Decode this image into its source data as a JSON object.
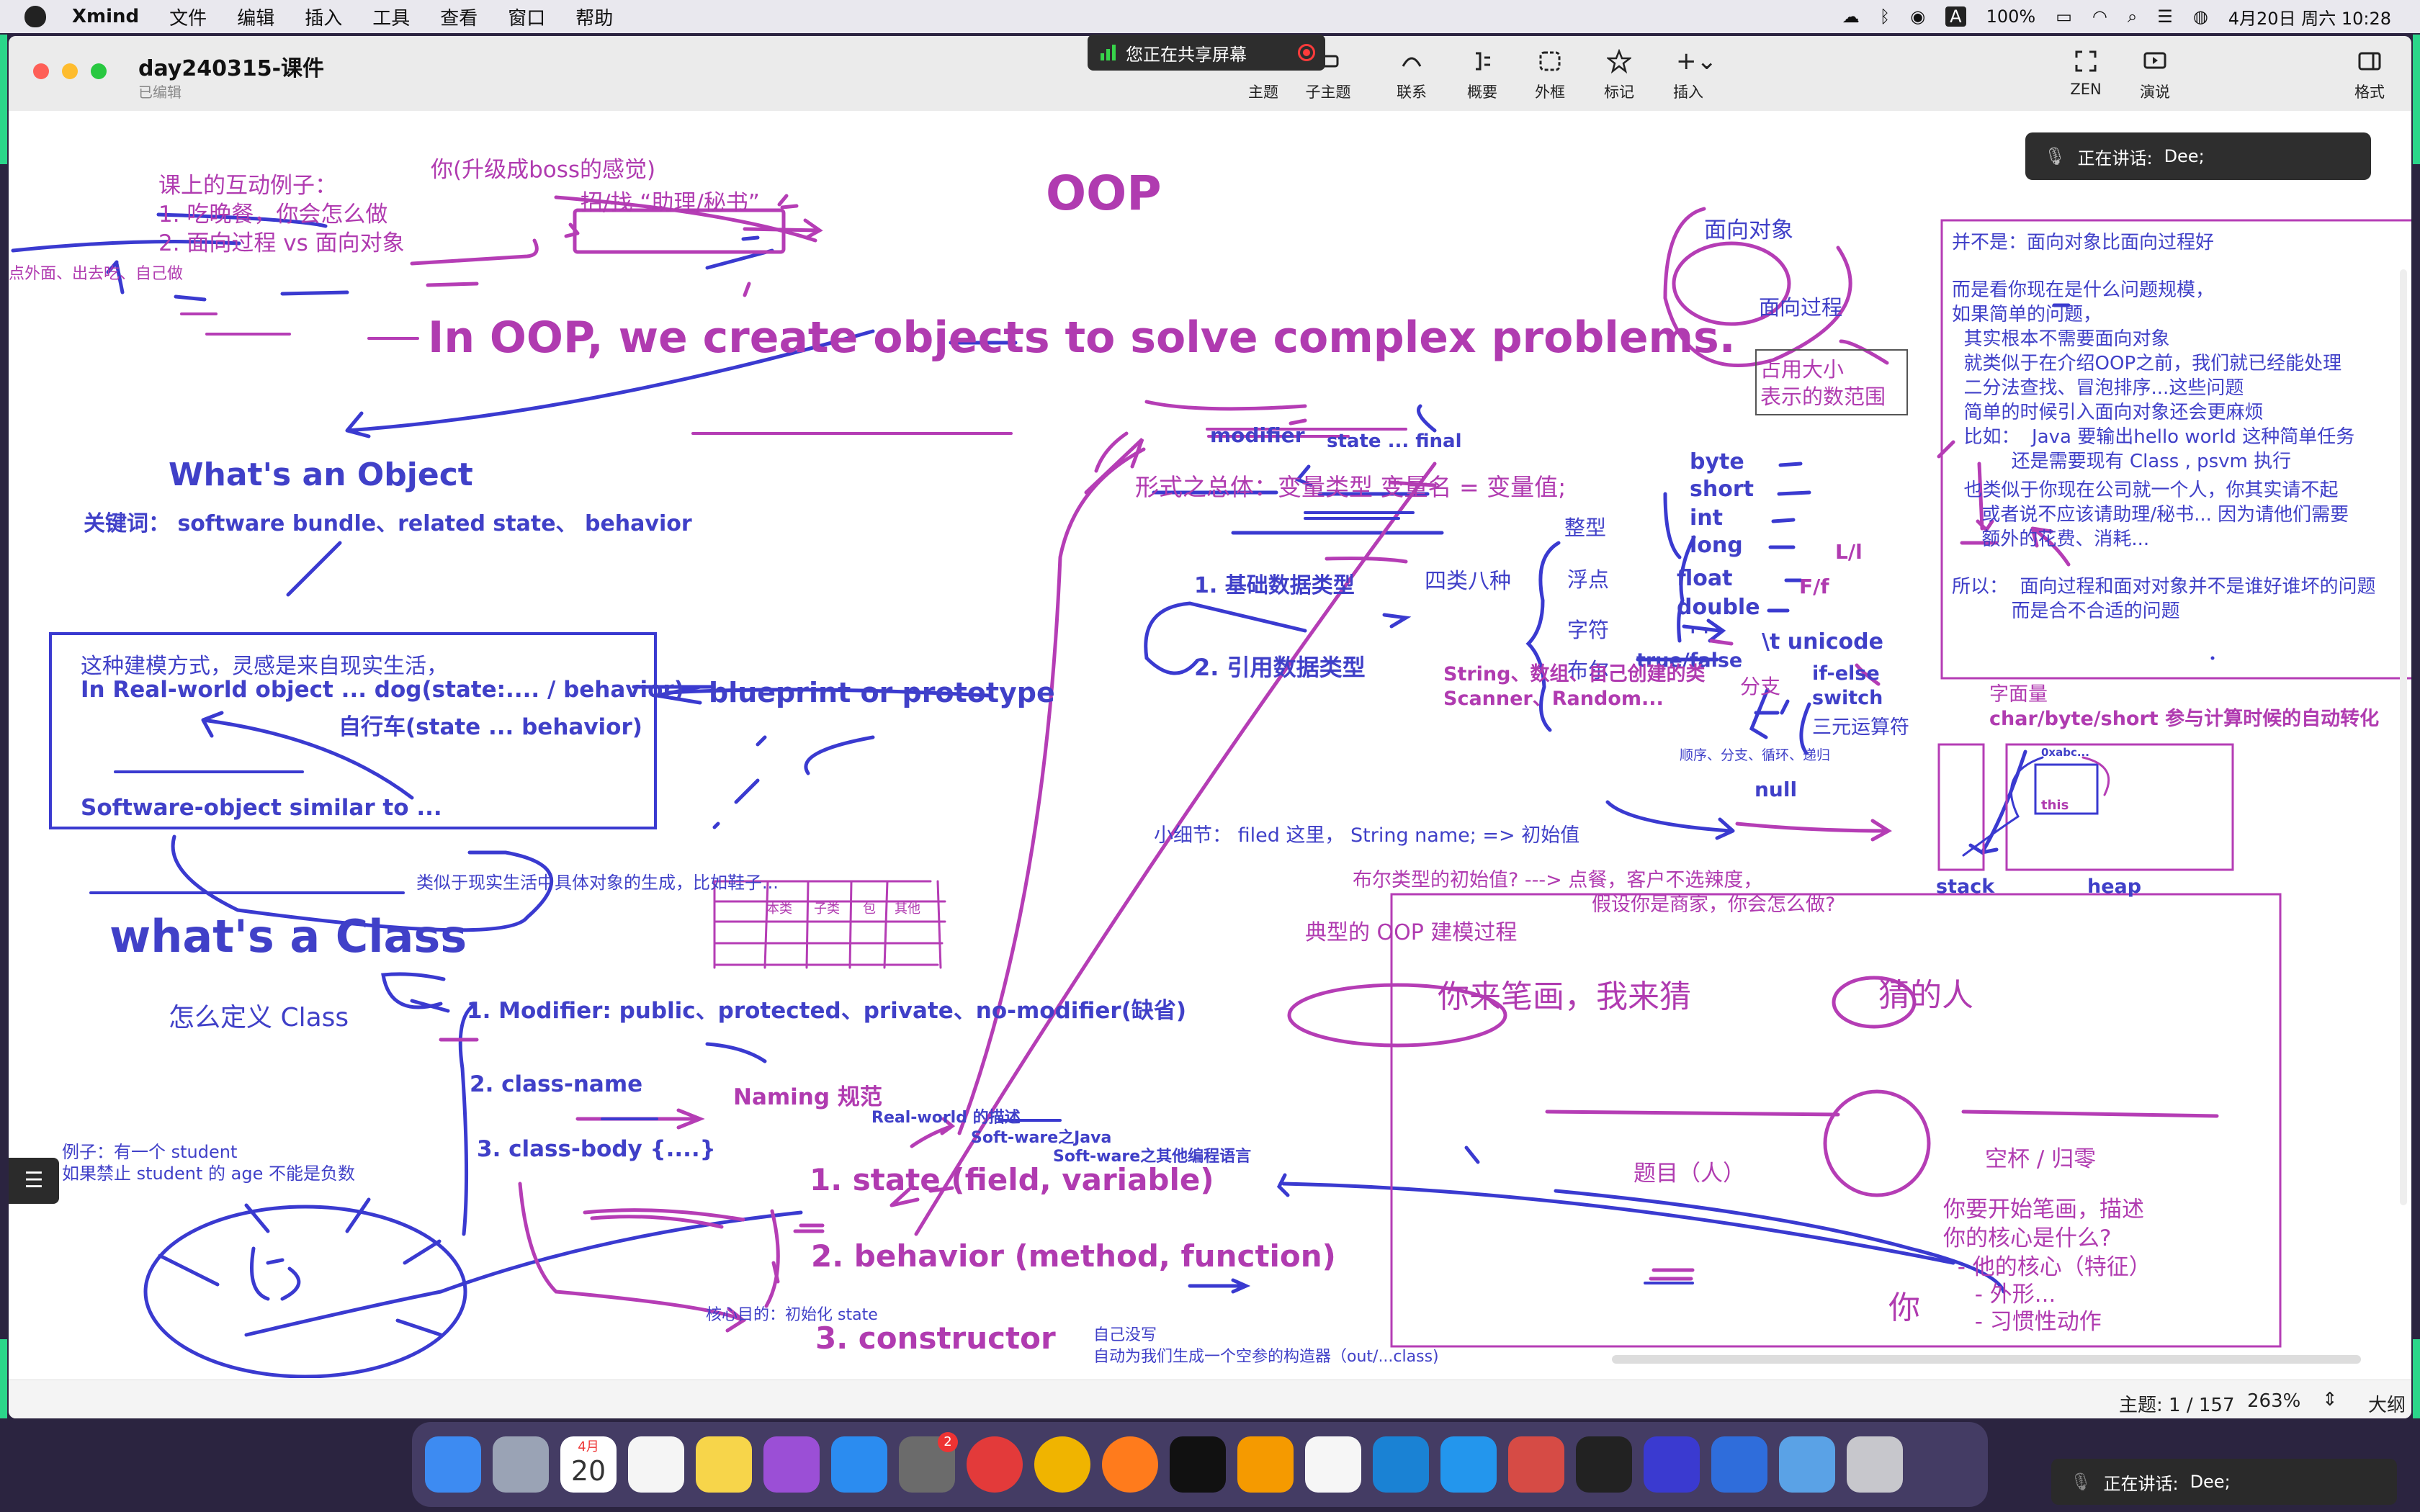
{
  "menubar": {
    "app_name": "Xmind",
    "menus": [
      "文件",
      "编辑",
      "插入",
      "工具",
      "查看",
      "窗口",
      "帮助"
    ],
    "battery": "100%",
    "datetime": "4月20日 周六  10:28"
  },
  "sharing_banner": {
    "label": "您正在共享屏幕"
  },
  "window": {
    "title": "day240315-课件",
    "subtitle": "已编辑",
    "toolbar": {
      "topic": "主题",
      "subtopic": "子主题",
      "relationship": "联系",
      "summary": "概要",
      "boundary": "外框",
      "marker": "标记",
      "insert": "插入",
      "zen": "ZEN",
      "pitch": "演说",
      "format": "格式"
    }
  },
  "speaking": {
    "label": "正在讲话:",
    "name": "Dee;"
  },
  "canvas": {
    "oop_title": "OOP",
    "headline": "In OOP, we create objects to solve complex problems.",
    "interactive": {
      "heading": "课上的互动例子：",
      "item1": "1. 吃晚餐，你会怎么做",
      "item2": "2. 面向过程 vs 面向对象",
      "side_note": "点外面、出去吃、自己做",
      "boss": "你(升级成boss的感觉)",
      "assistant": "招/找 “助理/秘书”"
    },
    "object": {
      "heading": "What's an Object",
      "keywords": "关键词：  software bundle、related state、 behavior",
      "box_line1": "这种建模方式，灵感是来自现实生活，",
      "box_line2": "In Real-world object ... dog(state:.... / behavior)",
      "box_line3": "自行车(state ... behavior)",
      "box_line4": "Software-object similar to ...",
      "blueprint": "blueprint or prototype",
      "analogy": "类似于现实生活中具体对象的生成，比如鞋子...",
      "grid_labels": [
        "本类",
        "子类",
        "包",
        "其他"
      ]
    },
    "class": {
      "heading": "what's a Class",
      "how": "怎么定义 Class",
      "modifier": "1. Modifier: public、protected、private、no-modifier(缺省)",
      "classname": "2. class-name",
      "naming": "Naming   规范",
      "classbody": "3. class-body  {....}",
      "example1": "例子：有一个 student",
      "example2": "如果禁止 student 的 age 不能是负数"
    },
    "members": {
      "state": "1. state (field, variable)",
      "behavior": "2. behavior (method, function)",
      "constructor": "3. constructor",
      "realworld": "Real-world 的描述",
      "software_java": "Soft-ware之Java",
      "software_other": "Soft-ware之其他编程语言",
      "core_purpose": "核心目的：初始化 state",
      "ctor_note1": "自己没写",
      "ctor_note2": "自动为我们生成一个空参的构造器（out/...class)"
    },
    "variables": {
      "modifier": "modifier",
      "state_final": "state ... final",
      "form": "形式之总体：变量类型 变量名 = 变量值;",
      "basic": "1. 基础数据类型",
      "four_eight": "四类八种",
      "integer": "整型",
      "float_kind": "浮点",
      "char_kind": "字符",
      "bool_kind": "布尔",
      "byte": "byte",
      "short": "short",
      "int": "int",
      "long": "long",
      "float": "float",
      "double": "double",
      "Ll": "L/l",
      "Ff": "F/f",
      "quote": "' '",
      "unicode": "\\t  unicode",
      "truefalse": "true/false",
      "branch": "分支",
      "ifelse": "if-else",
      "switch": "switch",
      "ternary": "三元运算符",
      "flow": "顺序、分支、循环、递归",
      "ref": "2. 引用数据类型",
      "ref_list1": "String、数组、自己创建的类",
      "ref_list2": "Scanner、Random...",
      "null": "null",
      "detail": "小细节： filed 这里，  String name;  => 初始值",
      "bool_q1": "布尔类型的初始值? ---> 点餐，客户不选辣度，",
      "bool_q2": "假设你是商家，你会怎么做?",
      "size1": "占用大小",
      "size2": "表示的数范围",
      "literal1": "字面量",
      "literal2": "char/byte/short 参与计算时候的自动转化"
    },
    "oo_bubble": {
      "outer": "面向对象",
      "inner": "面向过程"
    },
    "memory": {
      "stack": "stack",
      "heap": "heap",
      "addr": "0xabc...",
      "this": "this"
    },
    "note": {
      "l1": "并不是：面向对象比面向过程好",
      "l2": "而是看你现在是什么问题规模，",
      "l3": "如果简单的问题，",
      "l4": "  其实根本不需要面向对象",
      "l5": "  就类似于在介绍OOP之前，我们就已经能处理",
      "l6": "  二分法查找、冒泡排序...这些问题",
      "l7": "  简单的时候引入面向对象还会更麻烦",
      "l8": "  比如：  Java 要输出hello world 这种简单任务",
      "l9": "          还是需要现有 Class , psvm 执行",
      "l10": "  也类似于你现在公司就一个人，你其实请不起",
      "l11": "     或者说不应该请助理/秘书... 因为请他们需要",
      "l12": "     额外的花费、消耗...",
      "l13": "所以：  面向过程和面对对象并不是谁好谁坏的问题",
      "l14": "          而是合不合适的问题"
    },
    "game": {
      "label": "典型的 OOP 建模过程",
      "title": "你来笔画，我来猜",
      "guesser": "猜的人",
      "topic": "题目（人）",
      "empty": "空杯 / 归零",
      "q1": "你要开始笔画，描述",
      "q2": "你的核心是什么?",
      "q3": "  - 他的核心（特征）",
      "q4": "  - 外形...",
      "q5": "  - 习惯性动作",
      "you": "你"
    }
  },
  "status": {
    "topic_count": "主题: 1 / 157",
    "zoom": "263%",
    "outline": "大纲"
  },
  "dock": {
    "calendar_month": "4月",
    "calendar_day": "20",
    "badge": "2"
  }
}
